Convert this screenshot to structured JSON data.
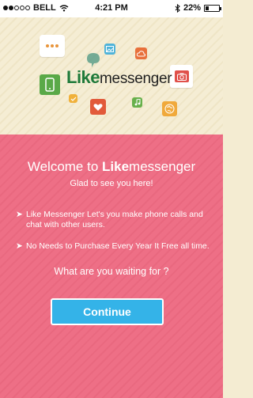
{
  "status_bar": {
    "carrier": "BELL",
    "time": "4:21 PM",
    "battery": "22%",
    "battery_level": 0.22
  },
  "logo": {
    "like": "Like",
    "messenger": "messenger"
  },
  "welcome": {
    "prefix": "Welcome to ",
    "brand_bold": "Like",
    "brand_rest": "messenger",
    "subtitle": "Glad to see you here!"
  },
  "bullets": [
    "Like Messenger Let's you make phone calls and chat with other users.",
    "No Needs to Purchase Every Year It Free all time."
  ],
  "question": "What are you waiting for ?",
  "continue_label": "Continue",
  "colors": {
    "hero_bg": "#f4ecd2",
    "panel_bg": "#ee6f86",
    "button": "#34b3e8",
    "brand_green": "#1f7a3a"
  },
  "icons": [
    "chat-bubble-icon",
    "phone-icon",
    "image-icon",
    "cloud-icon",
    "camera-icon",
    "check-icon",
    "heart-icon",
    "music-icon",
    "globe-icon"
  ]
}
